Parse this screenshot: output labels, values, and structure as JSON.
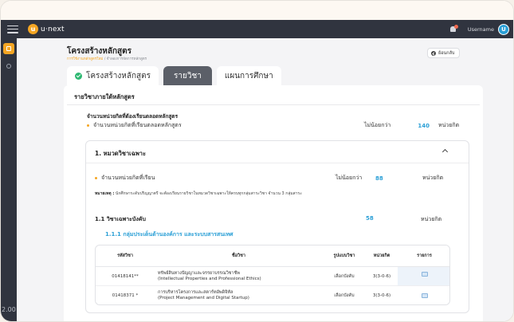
{
  "app": {
    "logo_letter": "u",
    "logo_text": "u·next",
    "username": "Username",
    "avatar_letter": "U",
    "sidebar_number": "2.00"
  },
  "page": {
    "title": "โครงสร้างหลักสูตร",
    "breadcrumb_link": "การใช้งานหลักสูตรใหม่",
    "breadcrumb_sep": "/",
    "breadcrumb_current": "จำลองการจัดการหลักสูตร",
    "back_label": "ย้อนกลับ"
  },
  "tabs": [
    {
      "label": "โครงสร้างหลักสูตร",
      "state": "done"
    },
    {
      "label": "รายวิชา",
      "state": "active"
    },
    {
      "label": "แผนการศึกษา",
      "state": "inactive"
    }
  ],
  "section": {
    "heading": "รายวิชาภายใต้หลักสูตร",
    "total_heading": "จำนวนหน่วยกิตที่ต้องเรียนตลอดหลักสูตร",
    "total_label": "จำนวนหน่วยกิตที่เรียนตลอดหลักสูตร",
    "total_qualifier": "ไม่น้อยกว่า",
    "total_value": "140",
    "total_unit": "หน่วยกิต"
  },
  "category": {
    "title": "1. หมวดวิชาเฉพาะ",
    "credit_label": "จำนวนหน่วยกิตที่เรียน",
    "credit_qualifier": "ไม่น้อยกว่า",
    "credit_value": "88",
    "credit_unit": "หน่วยกิต",
    "note_label": "หมายเหตุ :",
    "note_text": "นักศึกษาระดับปริญญาตรี จะต้องเรียนรายวิชาในหมวดวิชาเฉพาะให้ครบทุกกลุ่มสาระวิชา จำนวน 3 กลุ่มสาระ"
  },
  "subcategory": {
    "title": "1.1  วิชาเฉพาะบังคับ",
    "credit_value": "58",
    "credit_unit": "หน่วยกิต",
    "group_title": "1.1.1  กลุ่มประเด็นด้านองค์การ และระบบสารสนเทศ"
  },
  "table": {
    "headers": [
      "รหัสวิชา",
      "ชื่อวิชา",
      "รูปแบบวิชา",
      "หน่วยกิต",
      "รายการ"
    ],
    "rows": [
      {
        "code": "01418141**",
        "name_th": "ทรัพย์สินทางปัญญาและจรรยาบรรณวิชาชีพ",
        "name_en": "(Intellectual Properties and Professional Ethics)",
        "type": "เลือกบังคับ",
        "credits": "3(3-0-6)",
        "icon": "document-icon"
      },
      {
        "code": "01418371 *",
        "name_th": "การบริหารโครงการและสตาร์ทอัพดิจิทัล",
        "name_en": "(Project Management and Digital Startup)",
        "type": "เลือกบังคับ",
        "credits": "3(3-0-6)",
        "icon": "document-icon"
      }
    ]
  },
  "colors": {
    "accent": "#f5a623",
    "topbar": "#30343f",
    "link_blue": "#2a9fd6",
    "success": "#2eb872",
    "active_tab": "#5b5f68"
  }
}
